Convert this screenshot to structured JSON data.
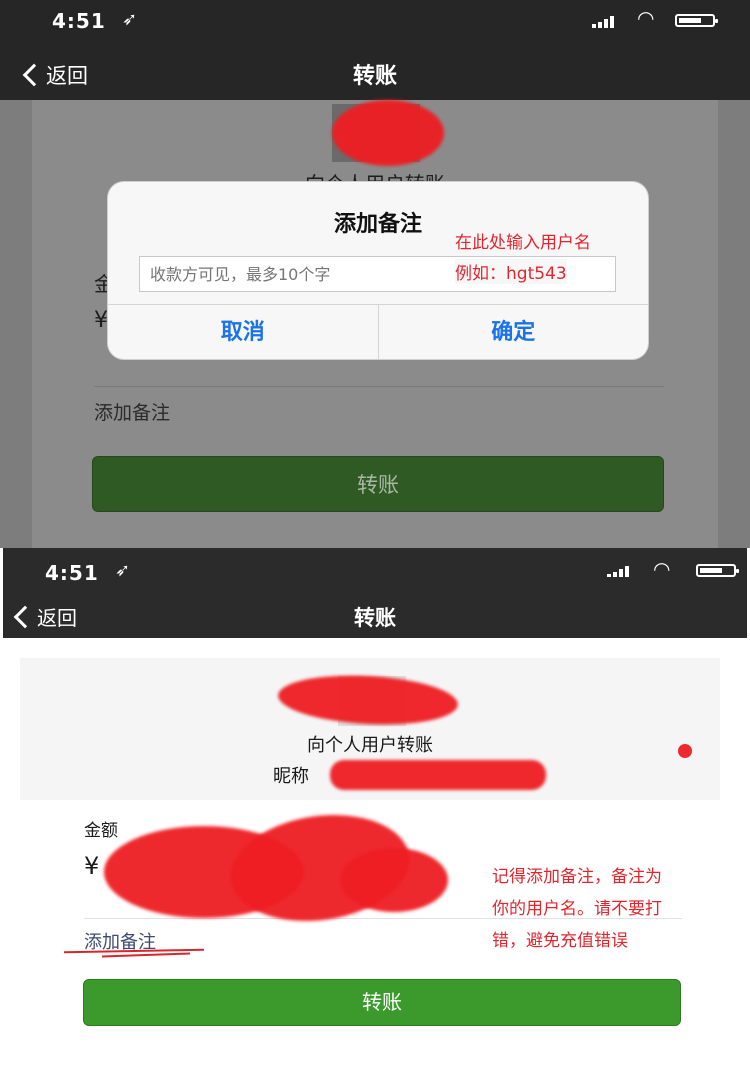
{
  "top": {
    "status": {
      "time": "4:51"
    },
    "nav": {
      "back": "返回",
      "title": "转账"
    },
    "card": {
      "payee_caption": "向个人用户转账",
      "amount_label_partial": "金",
      "currency_partial": "¥",
      "add_note": "添加备注",
      "transfer_button": "转账"
    },
    "dialog": {
      "title": "添加备注",
      "placeholder": "收款方可见，最多10个字",
      "cancel": "取消",
      "confirm": "确定"
    },
    "annotation": {
      "line1": "在此处输入用户名",
      "line2": "例如：hgt543"
    }
  },
  "bottom": {
    "status": {
      "time": "4:51"
    },
    "nav": {
      "back": "返回",
      "title": "转账"
    },
    "card": {
      "payee_caption": "向个人用户转账",
      "nickname_label": "昵称",
      "amount_label": "金额",
      "currency": "¥",
      "add_note": "添加备注",
      "transfer_button": "转账"
    },
    "annotation": {
      "line1": "记得添加备注，备注为",
      "line2": "你的用户名。请不要打",
      "line3": "错，避免充值错误"
    }
  },
  "colors": {
    "accent_green": "#3c9a2c",
    "dialog_blue": "#1a73e8",
    "annotation_red": "#e3262e",
    "redaction_red": "#ee1e23"
  }
}
